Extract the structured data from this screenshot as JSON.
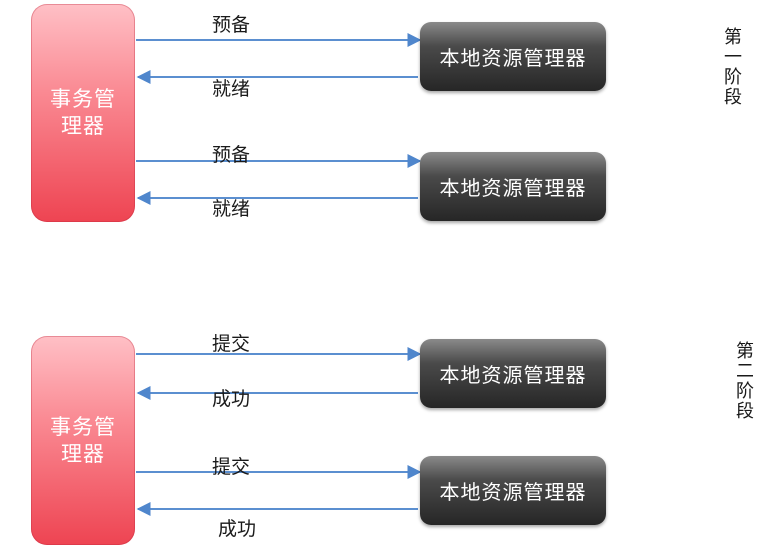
{
  "diagram": {
    "transaction_manager_label": "事务管理器",
    "resource_manager_label": "本地资源管理器",
    "colors": {
      "arrow": "#5b8fd0",
      "transaction_manager": "#f05c68",
      "resource_manager": "#333333"
    },
    "phase1": {
      "label": "第一阶段",
      "exchanges": [
        {
          "request": "预备",
          "response": "就绪"
        },
        {
          "request": "预备",
          "response": "就绪"
        }
      ]
    },
    "phase2": {
      "label": "第二阶段",
      "exchanges": [
        {
          "request": "提交",
          "response": "成功"
        },
        {
          "request": "提交",
          "response": "成功"
        }
      ]
    }
  }
}
